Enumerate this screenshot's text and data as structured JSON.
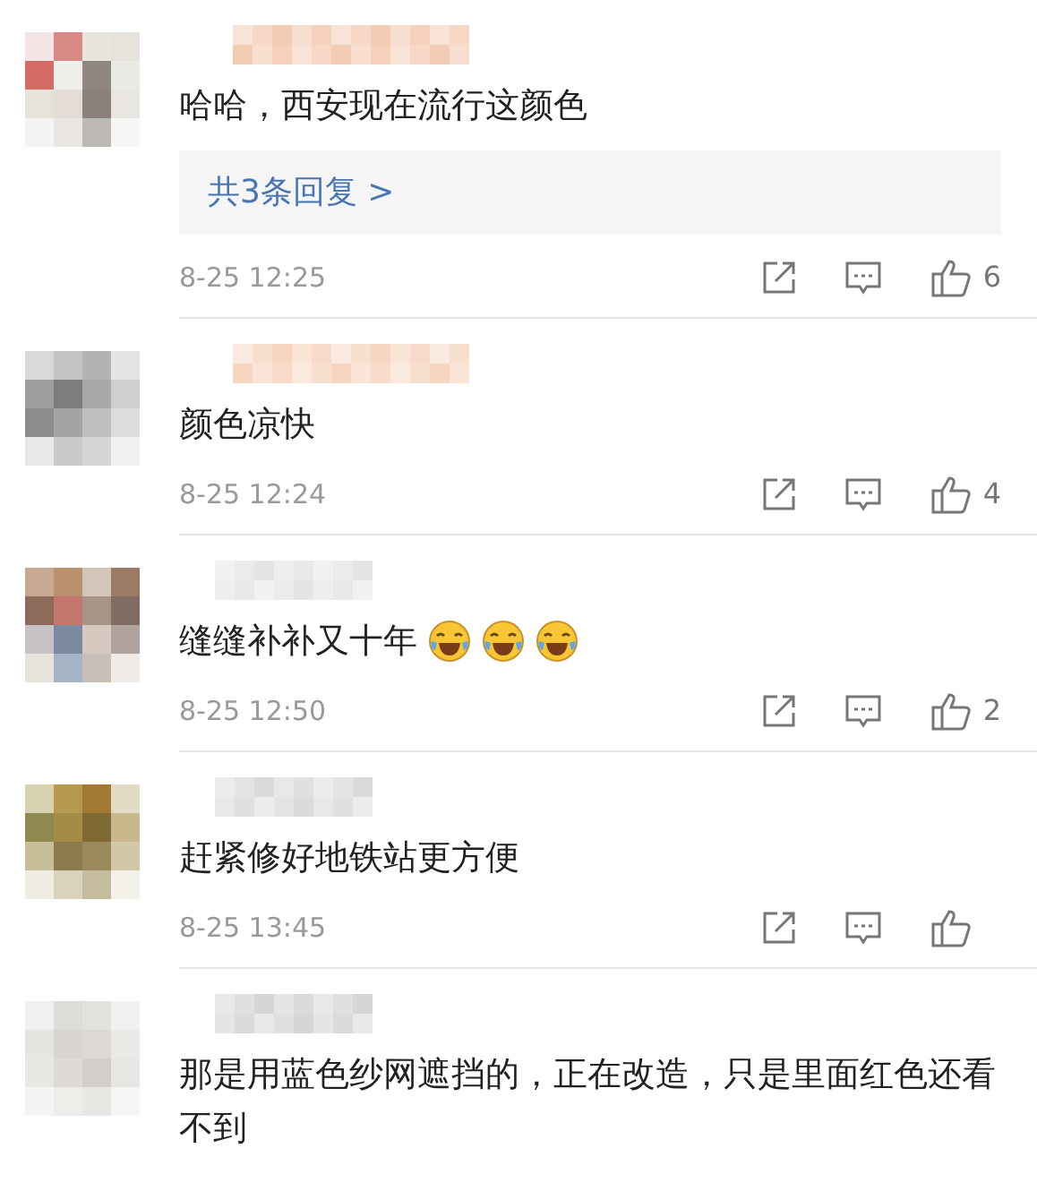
{
  "comments": [
    {
      "text": "哈哈，西安现在流行这颜色",
      "replies": "共3条回复 >",
      "time": "8-25 12:25",
      "likes": "6"
    },
    {
      "text": "颜色凉快",
      "time": "8-25 12:24",
      "likes": "4"
    },
    {
      "text": "缝缝补补又十年",
      "emojis": [
        {
          "kind": "laughing-crying"
        },
        {
          "kind": "laughing-crying"
        },
        {
          "kind": "laughing-crying"
        }
      ],
      "time": "8-25 12:50",
      "likes": "2"
    },
    {
      "text": "赶紧修好地铁站更方便",
      "time": "8-25 13:45"
    },
    {
      "text": "那是用蓝色纱网遮挡的，正在改造，只是里面红色还看不到"
    }
  ]
}
